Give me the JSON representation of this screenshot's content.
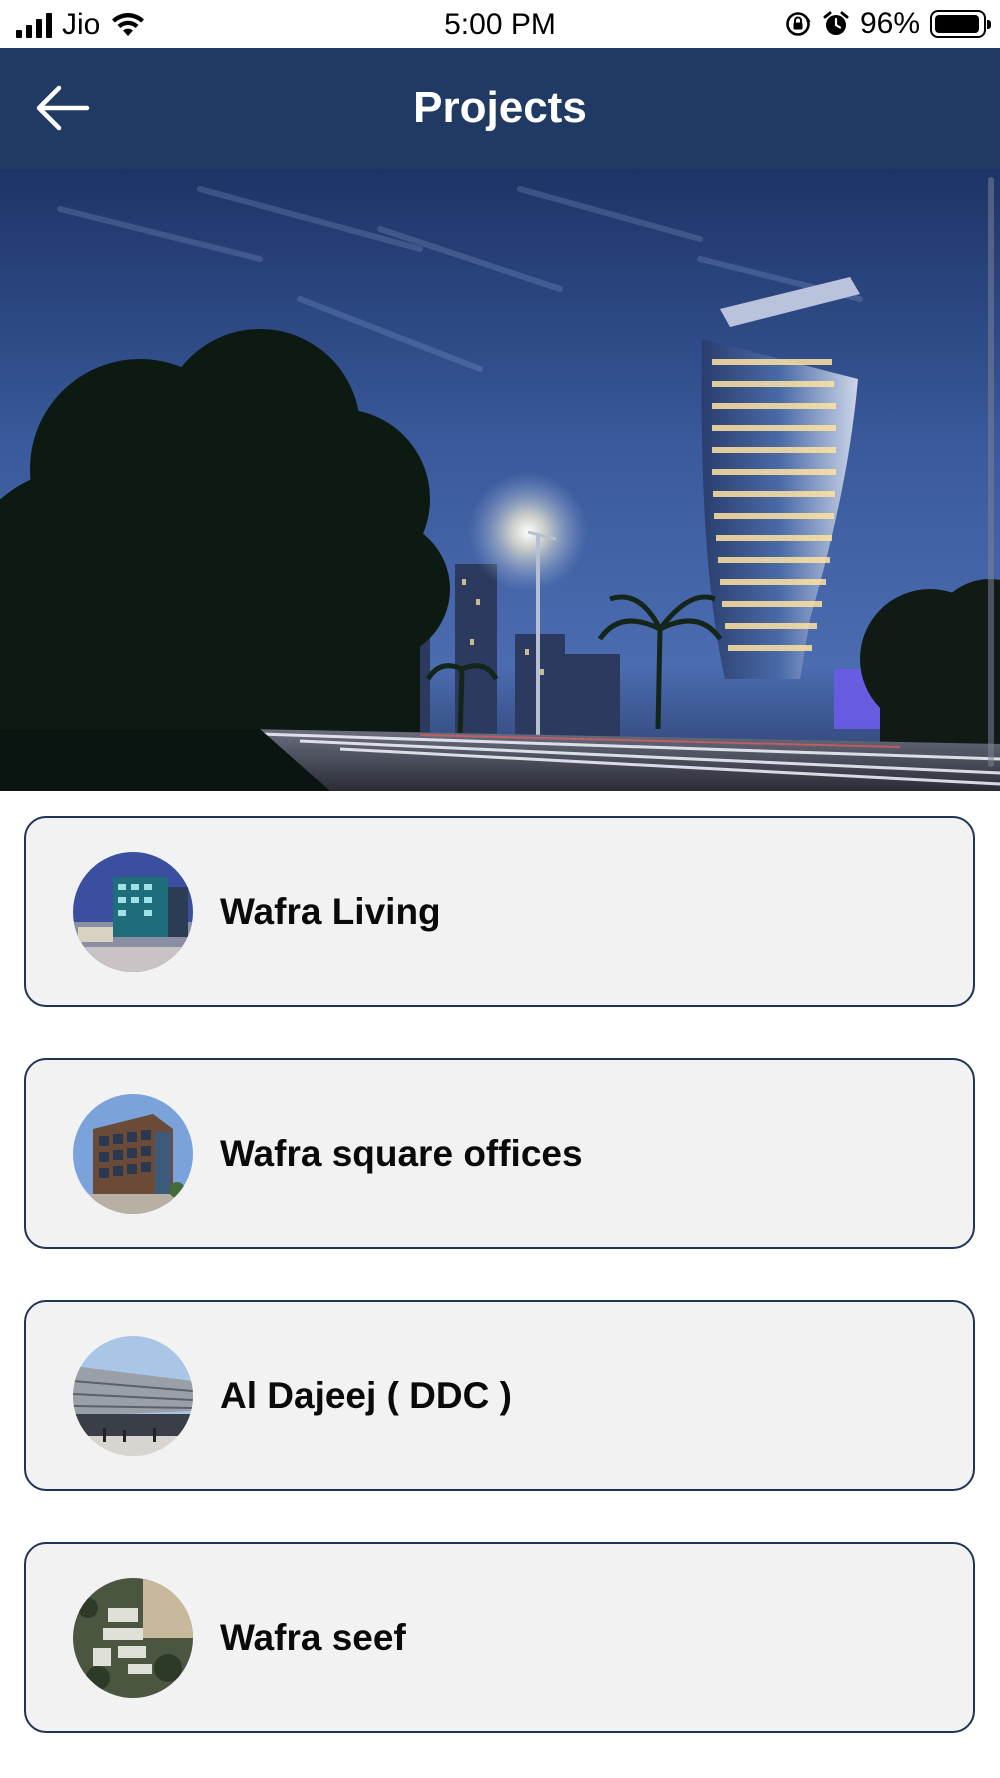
{
  "status_bar": {
    "carrier": "Jio",
    "time": "5:00 PM",
    "battery_percent": "96%",
    "battery_level": 0.96,
    "icons": [
      "signal-icon",
      "wifi-icon",
      "orientation-lock-icon",
      "alarm-icon",
      "battery-icon"
    ]
  },
  "header": {
    "title": "Projects",
    "back_icon": "arrow-left-icon"
  },
  "hero": {
    "description_icon": "hero-image"
  },
  "projects": [
    {
      "name": "Wafra Living"
    },
    {
      "name": "Wafra square offices"
    },
    {
      "name": "Al Dajeej ( DDC )"
    },
    {
      "name": "Wafra seef"
    }
  ],
  "colors": {
    "header_bg": "#203a63",
    "card_bg": "#f2f2f3",
    "card_border": "#1e3556",
    "title_text": "#ffffff"
  }
}
